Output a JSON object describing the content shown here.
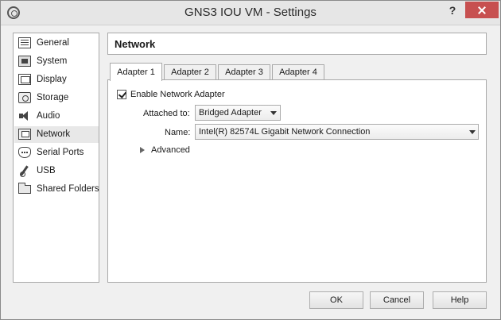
{
  "window": {
    "title": "GNS3 IOU VM - Settings",
    "help_glyph": "?"
  },
  "sidebar": {
    "items": [
      {
        "label": "General",
        "icon": "general-icon"
      },
      {
        "label": "System",
        "icon": "system-icon"
      },
      {
        "label": "Display",
        "icon": "display-icon"
      },
      {
        "label": "Storage",
        "icon": "storage-icon"
      },
      {
        "label": "Audio",
        "icon": "audio-icon"
      },
      {
        "label": "Network",
        "icon": "network-icon",
        "selected": true
      },
      {
        "label": "Serial Ports",
        "icon": "serial-port-icon"
      },
      {
        "label": "USB",
        "icon": "usb-icon"
      },
      {
        "label": "Shared Folders",
        "icon": "folder-icon"
      }
    ]
  },
  "header": {
    "title": "Network"
  },
  "tabs": [
    {
      "label": "Adapter 1",
      "active": true
    },
    {
      "label": "Adapter 2"
    },
    {
      "label": "Adapter 3"
    },
    {
      "label": "Adapter 4"
    }
  ],
  "adapter": {
    "enable_label": "Enable Network Adapter",
    "enabled": true,
    "attached_to_label": "Attached to:",
    "attached_to_value": "Bridged Adapter",
    "name_label": "Name:",
    "name_value": "Intel(R) 82574L Gigabit Network Connection",
    "advanced_label": "Advanced"
  },
  "buttons": {
    "ok": "OK",
    "cancel": "Cancel",
    "help": "Help"
  }
}
